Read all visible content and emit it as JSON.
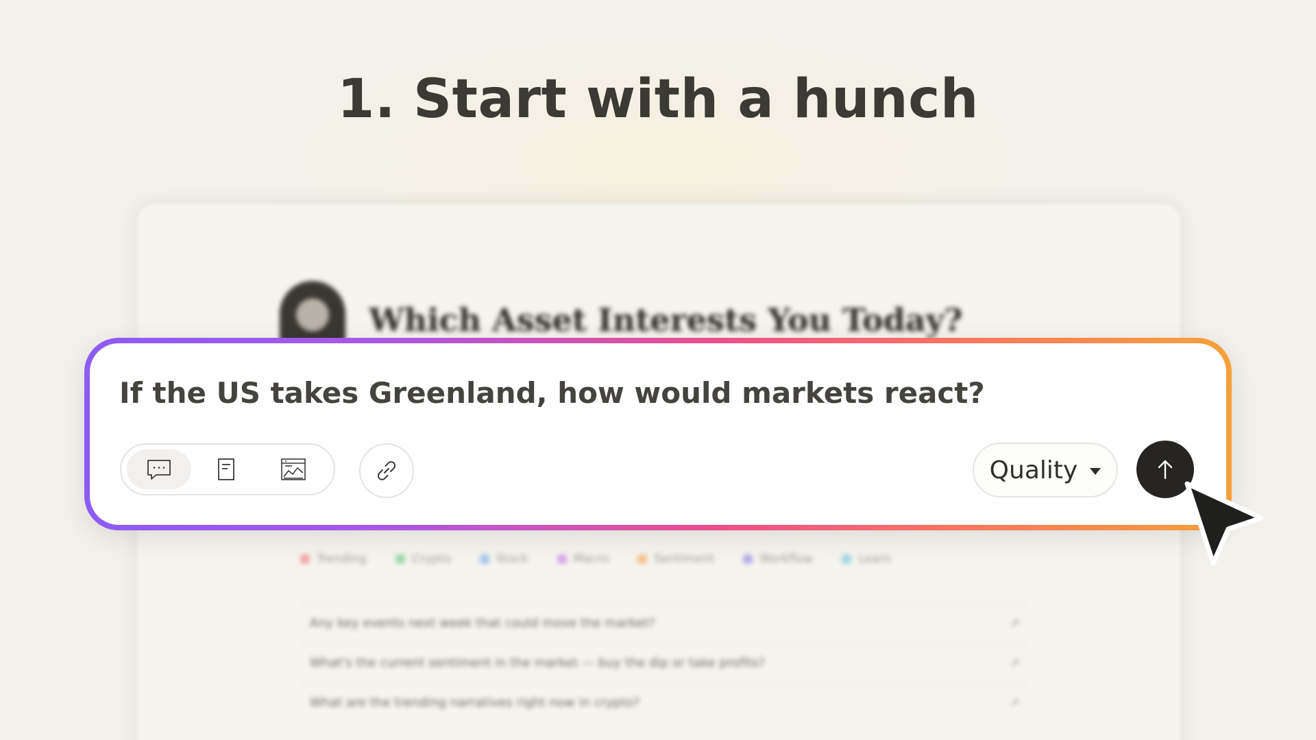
{
  "heading": {
    "number": "1.",
    "text": "Start with a hunch"
  },
  "background_app": {
    "title": "Which Asset Interests You Today?",
    "tabs": [
      {
        "label": "Trending",
        "color": "#f4a6a6"
      },
      {
        "label": "Crypto",
        "color": "#9fd8a8"
      },
      {
        "label": "Stock",
        "color": "#a9c6ec"
      },
      {
        "label": "Macro",
        "color": "#d6a8e8"
      },
      {
        "label": "Sentiment",
        "color": "#f6c28d"
      },
      {
        "label": "Workflow",
        "color": "#b5aeea"
      },
      {
        "label": "Learn",
        "color": "#9fd6e6"
      }
    ],
    "suggestions": [
      "Any key events next week that could move the market?",
      "What's the current sentiment in the market — buy the dip or take profits?",
      "What are the trending narratives right now in crypto?"
    ],
    "suggestion_arrow": "↗"
  },
  "prompt": {
    "text": "If the US takes Greenland, how would markets react?",
    "modes": [
      {
        "icon": "chat-bubble-icon",
        "active": true
      },
      {
        "icon": "document-icon",
        "active": false
      },
      {
        "icon": "chart-report-icon",
        "active": false
      }
    ],
    "attach_icon": "link-icon",
    "quality_label": "Quality",
    "send_icon": "arrow-up-icon"
  },
  "colors": {
    "gradient_start": "#8b5cf6",
    "gradient_mid": "#ec4f8c",
    "gradient_end": "#f7a13a",
    "send_button": "#262523",
    "heading": "#3b3a34"
  }
}
